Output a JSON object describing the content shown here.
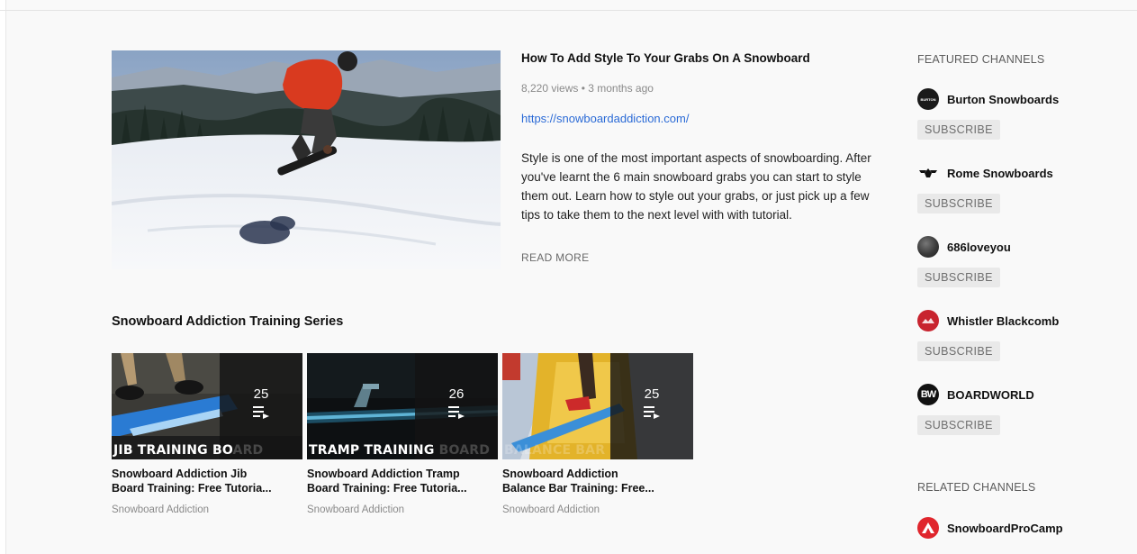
{
  "featured": {
    "title": "How To Add Style To Your Grabs On A Snowboard",
    "meta": "8,220 views • 3 months ago",
    "link": "https://snowboardaddiction.com/",
    "description": "Style is one of the most important aspects of snowboarding. After you've learnt the 6 main snowboard grabs you can start to style them out. Learn how to style out your grabs, or just pick up a few tips to take them to the next level with with tutorial.",
    "read_more": "READ MORE"
  },
  "playlists": {
    "section_title": "Snowboard Addiction Training Series",
    "items": [
      {
        "count": "25",
        "banner_bold": "JIB TRAINING BO",
        "banner_fade": "ARD",
        "title_line1": "Snowboard Addiction Jib",
        "title_line2": "Board Training: Free Tutoria...",
        "channel": "Snowboard Addiction"
      },
      {
        "count": "26",
        "banner_bold": "TRAMP TRAINING ",
        "banner_fade": "BOARD",
        "title_line1": "Snowboard Addiction Tramp",
        "title_line2": "Board Training: Free Tutoria...",
        "channel": "Snowboard Addiction"
      },
      {
        "count": "25",
        "banner_bold": "",
        "banner_fade": "BALANCE BAR",
        "title_line1": "Snowboard Addiction",
        "title_line2": "Balance Bar Training: Free...",
        "channel": "Snowboard Addiction"
      }
    ]
  },
  "sidebar": {
    "featured_heading": "FEATURED CHANNELS",
    "channels": [
      {
        "name": "Burton Snowboards",
        "subscribe": "SUBSCRIBE",
        "avatar_text": "BURTON",
        "avatar_color": "#1a1a1a"
      },
      {
        "name": "Rome Snowboards",
        "subscribe": "SUBSCRIBE",
        "avatar_color": "#111111"
      },
      {
        "name": "686loveyou",
        "subscribe": "SUBSCRIBE",
        "avatar_color": "#3a3a3a"
      },
      {
        "name": "Whistler Blackcomb",
        "subscribe": "SUBSCRIBE",
        "avatar_color": "#c8242f"
      },
      {
        "name": "BOARDWORLD",
        "subscribe": "SUBSCRIBE",
        "avatar_text": "BW",
        "avatar_color": "#111111"
      }
    ],
    "related_heading": "RELATED CHANNELS",
    "related": [
      {
        "name": "SnowboardProCamp",
        "avatar_color": "#e0262d"
      }
    ]
  }
}
